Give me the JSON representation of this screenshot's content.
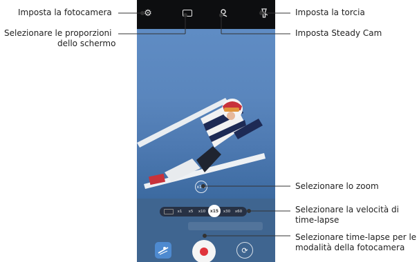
{
  "callouts": {
    "settings": "Imposta la fotocamera",
    "ratio_line1": "Selezionare le proporzioni",
    "ratio_line2": "dello schermo",
    "torch": "Imposta la torcia",
    "steady": "Imposta Steady Cam",
    "zoom": "Selezionare lo zoom",
    "speed_line1": "Selezionare la velocità di",
    "speed_line2": "time-lapse",
    "mode_line1": "Selezionare time-lapse per le",
    "mode_line2": "modalità della fotocamera"
  },
  "camera": {
    "zoom_value": "x1.0",
    "speed_options": [
      "x1",
      "x5",
      "x10",
      "x15",
      "x30",
      "x60"
    ],
    "speed_selected": "x15"
  },
  "icons": {
    "settings": "gear-icon",
    "ratio": "aspect-ratio-icon",
    "steady": "steady-cam-icon",
    "torch": "torch-icon",
    "gallery": "gallery-thumbnail",
    "record": "record-icon",
    "switch": "switch-camera-icon"
  },
  "colors": {
    "record": "#e0343c",
    "sky": "#5a86bd",
    "topbar": "#0d0e10"
  }
}
